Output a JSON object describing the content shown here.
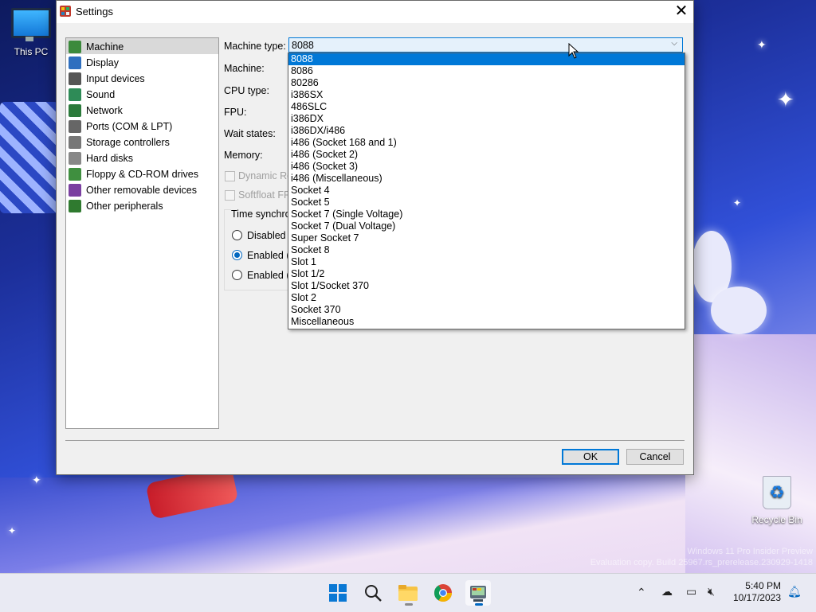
{
  "desktop": {
    "this_pc_label": "This PC",
    "recycle_bin_label": "Recycle Bin",
    "watermark_line1": "Windows 11 Pro Insider Preview",
    "watermark_line2": "Evaluation copy. Build 25967.rs_prerelease.230929-1418"
  },
  "dialog": {
    "title": "Settings",
    "close_glyph": "✕",
    "nav": [
      {
        "label": "Machine",
        "icon": "machine-icon",
        "color": "#3c8a3c"
      },
      {
        "label": "Display",
        "icon": "display-icon",
        "color": "#2f6fbf"
      },
      {
        "label": "Input devices",
        "icon": "keyboard-icon",
        "color": "#555555"
      },
      {
        "label": "Sound",
        "icon": "speaker-icon",
        "color": "#2e8b57"
      },
      {
        "label": "Network",
        "icon": "network-icon",
        "color": "#2b7a3b"
      },
      {
        "label": "Ports (COM & LPT)",
        "icon": "ports-icon",
        "color": "#666666"
      },
      {
        "label": "Storage controllers",
        "icon": "storage-icon",
        "color": "#777777"
      },
      {
        "label": "Hard disks",
        "icon": "hard-disk-icon",
        "color": "#888888"
      },
      {
        "label": "Floppy & CD-ROM drives",
        "icon": "floppy-icon",
        "color": "#3f8f3f"
      },
      {
        "label": "Other removable devices",
        "icon": "removable-icon",
        "color": "#7a3fa0"
      },
      {
        "label": "Other peripherals",
        "icon": "peripherals-icon",
        "color": "#2f7a2f"
      }
    ],
    "machine_type_label": "Machine type:",
    "machine_type_value": "8088",
    "machine_label": "Machine:",
    "cpu_type_label": "CPU type:",
    "fpu_label": "FPU:",
    "wait_states_label": "Wait states:",
    "memory_label": "Memory:",
    "dynamic_label": "Dynamic Re",
    "softfloat_label": "Softfloat FPU",
    "time_sync_label": "Time synchro",
    "radio_disabled": "Disabled",
    "radio_enabled_local": "Enabled (l",
    "radio_enabled_utc": "Enabled (U",
    "ok_label": "OK",
    "cancel_label": "Cancel",
    "dropdown_options": [
      "8088",
      "8086",
      "80286",
      "i386SX",
      "486SLC",
      "i386DX",
      "i386DX/i486",
      "i486 (Socket 168 and 1)",
      "i486 (Socket 2)",
      "i486 (Socket 3)",
      "i486 (Miscellaneous)",
      "Socket 4",
      "Socket 5",
      "Socket 7 (Single Voltage)",
      "Socket 7 (Dual Voltage)",
      "Super Socket 7",
      "Socket 8",
      "Slot 1",
      "Slot 1/2",
      "Slot 1/Socket 370",
      "Slot 2",
      "Socket 370",
      "Miscellaneous"
    ],
    "selected_option": "8088"
  },
  "taskbar": {
    "time": "5:40 PM",
    "date": "10/17/2023",
    "apps": [
      "windows-start-icon",
      "search-icon",
      "file-explorer-icon",
      "chrome-icon",
      "86box-icon"
    ]
  }
}
